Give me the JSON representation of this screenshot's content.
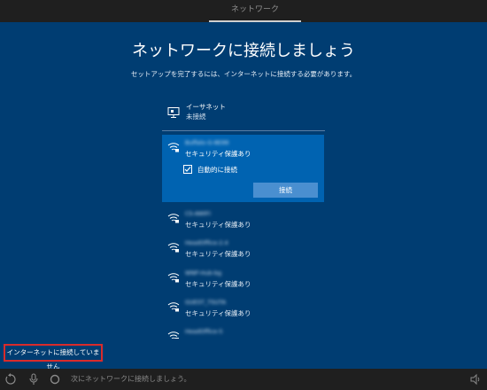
{
  "window": {
    "tab_title": "ネットワーク"
  },
  "page": {
    "title": "ネットワークに接続しましょう",
    "subtitle": "セットアップを完了するには、インターネットに接続する必要があります。"
  },
  "ethernet": {
    "name": "イーサネット",
    "status": "未接続"
  },
  "selected_network": {
    "ssid": "Buffalo-G-8E99",
    "security": "セキュリティ保護あり",
    "auto_connect_label": "自動的に接続",
    "auto_connect_checked": true,
    "connect_button": "接続"
  },
  "networks": [
    {
      "ssid": "CS-AWIFI",
      "security": "セキュリティ保護あり"
    },
    {
      "ssid": "HeadOffice-2.4",
      "security": "セキュリティ保護あり"
    },
    {
      "ssid": "WNP-Hub-bg",
      "security": "セキュリティ保護あり"
    },
    {
      "ssid": "GUEST_TSUTA",
      "security": "セキュリティ保護あり"
    },
    {
      "ssid": "HeadOffice-5",
      "security": ""
    }
  ],
  "status_message": "インターネットに接続していません",
  "taskbar": {
    "prompt_text": "次にネットワークに接続しましょう。"
  },
  "colors": {
    "background": "#003d72",
    "selected": "#0063b1",
    "button": "#4a8fd0",
    "highlight_border": "#d92b2b"
  }
}
